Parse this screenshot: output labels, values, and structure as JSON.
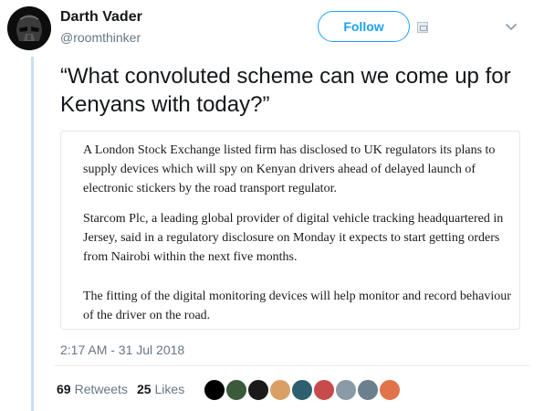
{
  "tweet": {
    "author_name": "Darth Vader",
    "author_handle": "@roomthinker",
    "follow_label": "Follow",
    "text": "“What convoluted scheme can we come up for Kenyans with today?”",
    "timestamp": "2:17 AM - 31 Jul 2018",
    "retweets": {
      "count": "69",
      "label": "Retweets"
    },
    "likes": {
      "count": "25",
      "label": "Likes"
    }
  },
  "quote": {
    "paragraphs": [
      "A London Stock Exchange listed firm has disclosed to UK regulators its plans to supply devices which will spy on Kenyan drivers ahead of delayed launch of electronic stickers by the road transport regulator.",
      "Starcom Plc, a leading global provider of digital vehicle tracking headquartered in Jersey, said in a regulatory disclosure on Monday it expects to start getting orders from Nairobi within the next five months.",
      "The fitting of the digital monitoring devices will help monitor and record behaviour of the driver on the road."
    ]
  },
  "liker_colors": [
    "#000000",
    "#3a5a3a",
    "#1a1a1a",
    "#d9a066",
    "#2e5f6e",
    "#c84b4b",
    "#8a9aa6",
    "#6b7f8c",
    "#e0734a"
  ],
  "colors": {
    "accent": "#1da1f2",
    "text": "#14171a",
    "muted": "#657786",
    "thread_line": "#c8dff2"
  }
}
